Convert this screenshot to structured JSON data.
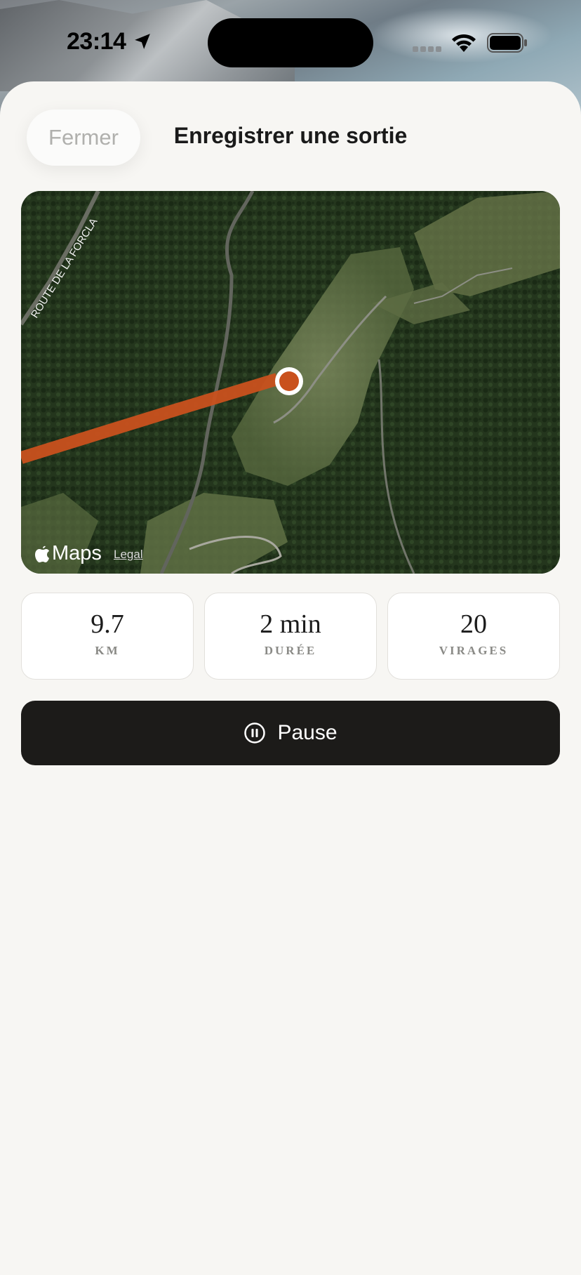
{
  "status_bar": {
    "time": "23:14"
  },
  "header": {
    "close_label": "Fermer",
    "title": "Enregistrer une sortie"
  },
  "map": {
    "road_label": "ROUTE DE LA FORCLA",
    "provider": "Maps",
    "legal_label": "Legal",
    "track_color": "#c9511d"
  },
  "stats": [
    {
      "value": "9.7",
      "label": "KM"
    },
    {
      "value": "2 min",
      "label": "DURÉE"
    },
    {
      "value": "20",
      "label": "VIRAGES"
    }
  ],
  "actions": {
    "pause_label": "Pause",
    "pause_icon": "pause-circle-icon"
  }
}
